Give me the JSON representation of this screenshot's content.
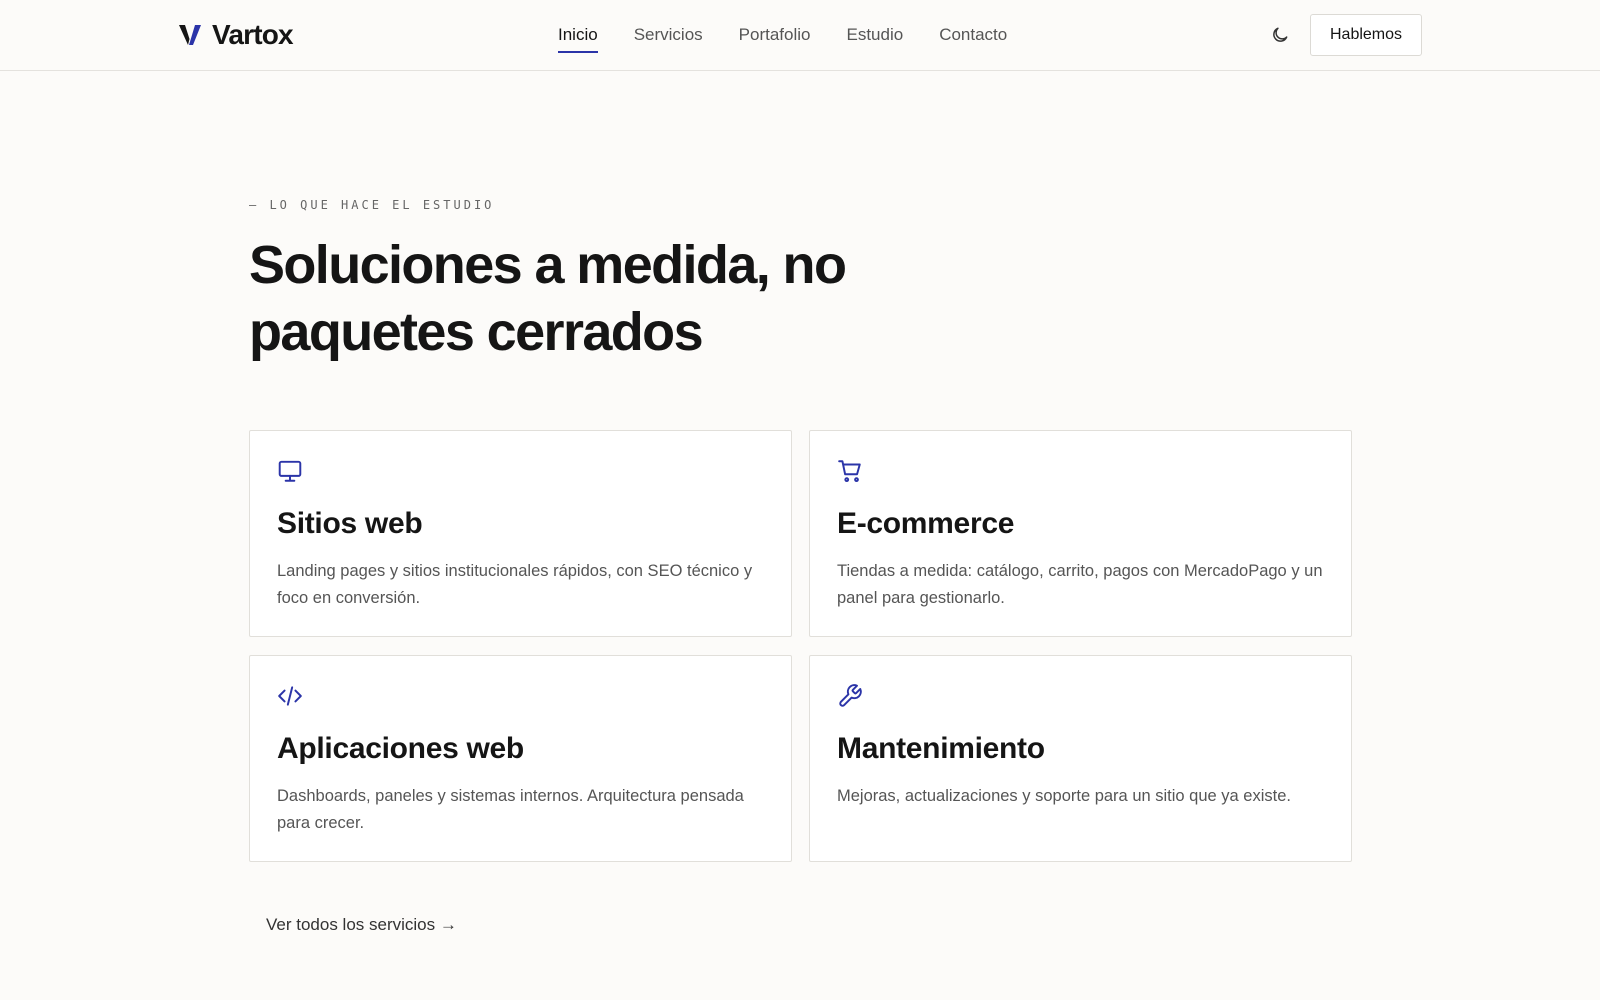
{
  "brand": {
    "name": "Vartox",
    "accent": "#2b34a8"
  },
  "nav": {
    "items": [
      {
        "label": "Inicio",
        "active": true
      },
      {
        "label": "Servicios",
        "active": false
      },
      {
        "label": "Portafolio",
        "active": false
      },
      {
        "label": "Estudio",
        "active": false
      },
      {
        "label": "Contacto",
        "active": false
      }
    ],
    "theme_icon": "moon-icon",
    "cta_label": "Hablemos"
  },
  "hero": {
    "eyebrow": "— LO QUE HACE EL ESTUDIO",
    "title": "Soluciones a medida, no paquetes cerrados"
  },
  "services": [
    {
      "icon": "monitor-icon",
      "title": "Sitios web",
      "description": "Landing pages y sitios institucionales rápidos, con SEO técnico y foco en conversión."
    },
    {
      "icon": "shopping-cart-icon",
      "title": "E-commerce",
      "description": "Tiendas a medida: catálogo, carrito, pagos con MercadoPago y un panel para gestionarlo."
    },
    {
      "icon": "code-icon",
      "title": "Aplicaciones web",
      "description": "Dashboards, paneles y sistemas internos. Arquitectura pensada para crecer."
    },
    {
      "icon": "wrench-icon",
      "title": "Mantenimiento",
      "description": "Mejoras, actualizaciones y soporte para un sitio que ya existe."
    }
  ],
  "footer_link": {
    "label": "Ver todos los servicios →"
  }
}
